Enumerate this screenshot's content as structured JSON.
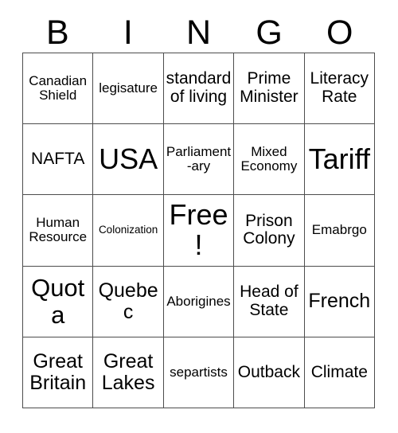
{
  "card": {
    "header": {
      "letters": [
        "B",
        "I",
        "N",
        "G",
        "O"
      ]
    },
    "columns": 5,
    "rows": 5,
    "colors": {
      "background": "#ffffff",
      "grid_line": "#4d4d4d",
      "text": "#000000"
    },
    "cells": [
      {
        "text": "Canadian Shield",
        "size": "sm",
        "column": "B",
        "row": 1
      },
      {
        "text": "legisature",
        "size": "sm",
        "column": "I",
        "row": 1
      },
      {
        "text": "standard of living",
        "size": "md",
        "column": "N",
        "row": 1
      },
      {
        "text": "Prime Minister",
        "size": "md",
        "column": "G",
        "row": 1
      },
      {
        "text": "Literacy Rate",
        "size": "md",
        "column": "O",
        "row": 1
      },
      {
        "text": "NAFTA",
        "size": "md",
        "column": "B",
        "row": 2
      },
      {
        "text": "USA",
        "size": "xxl",
        "column": "I",
        "row": 2
      },
      {
        "text": "Parliament-ary",
        "size": "sm",
        "column": "N",
        "row": 2
      },
      {
        "text": "Mixed Economy",
        "size": "sm",
        "column": "G",
        "row": 2
      },
      {
        "text": "Tariff",
        "size": "xxl",
        "column": "O",
        "row": 2
      },
      {
        "text": "Human Resource",
        "size": "sm",
        "column": "B",
        "row": 3
      },
      {
        "text": "Colonization",
        "size": "xs",
        "column": "I",
        "row": 3
      },
      {
        "text": "Free!",
        "size": "xxl",
        "column": "N",
        "row": 3
      },
      {
        "text": "Prison Colony",
        "size": "md",
        "column": "G",
        "row": 3
      },
      {
        "text": "Emabrgo",
        "size": "sm",
        "column": "O",
        "row": 3
      },
      {
        "text": "Quota",
        "size": "xl",
        "column": "B",
        "row": 4
      },
      {
        "text": "Quebec",
        "size": "lg",
        "column": "I",
        "row": 4
      },
      {
        "text": "Aborigines",
        "size": "sm",
        "column": "N",
        "row": 4
      },
      {
        "text": "Head of State",
        "size": "md",
        "column": "G",
        "row": 4
      },
      {
        "text": "French",
        "size": "lg",
        "column": "O",
        "row": 4
      },
      {
        "text": "Great Britain",
        "size": "lg",
        "column": "B",
        "row": 5
      },
      {
        "text": "Great Lakes",
        "size": "lg",
        "column": "I",
        "row": 5
      },
      {
        "text": "separtists",
        "size": "sm",
        "column": "N",
        "row": 5
      },
      {
        "text": "Outback",
        "size": "md",
        "column": "G",
        "row": 5
      },
      {
        "text": "Climate",
        "size": "md",
        "column": "O",
        "row": 5
      }
    ]
  }
}
